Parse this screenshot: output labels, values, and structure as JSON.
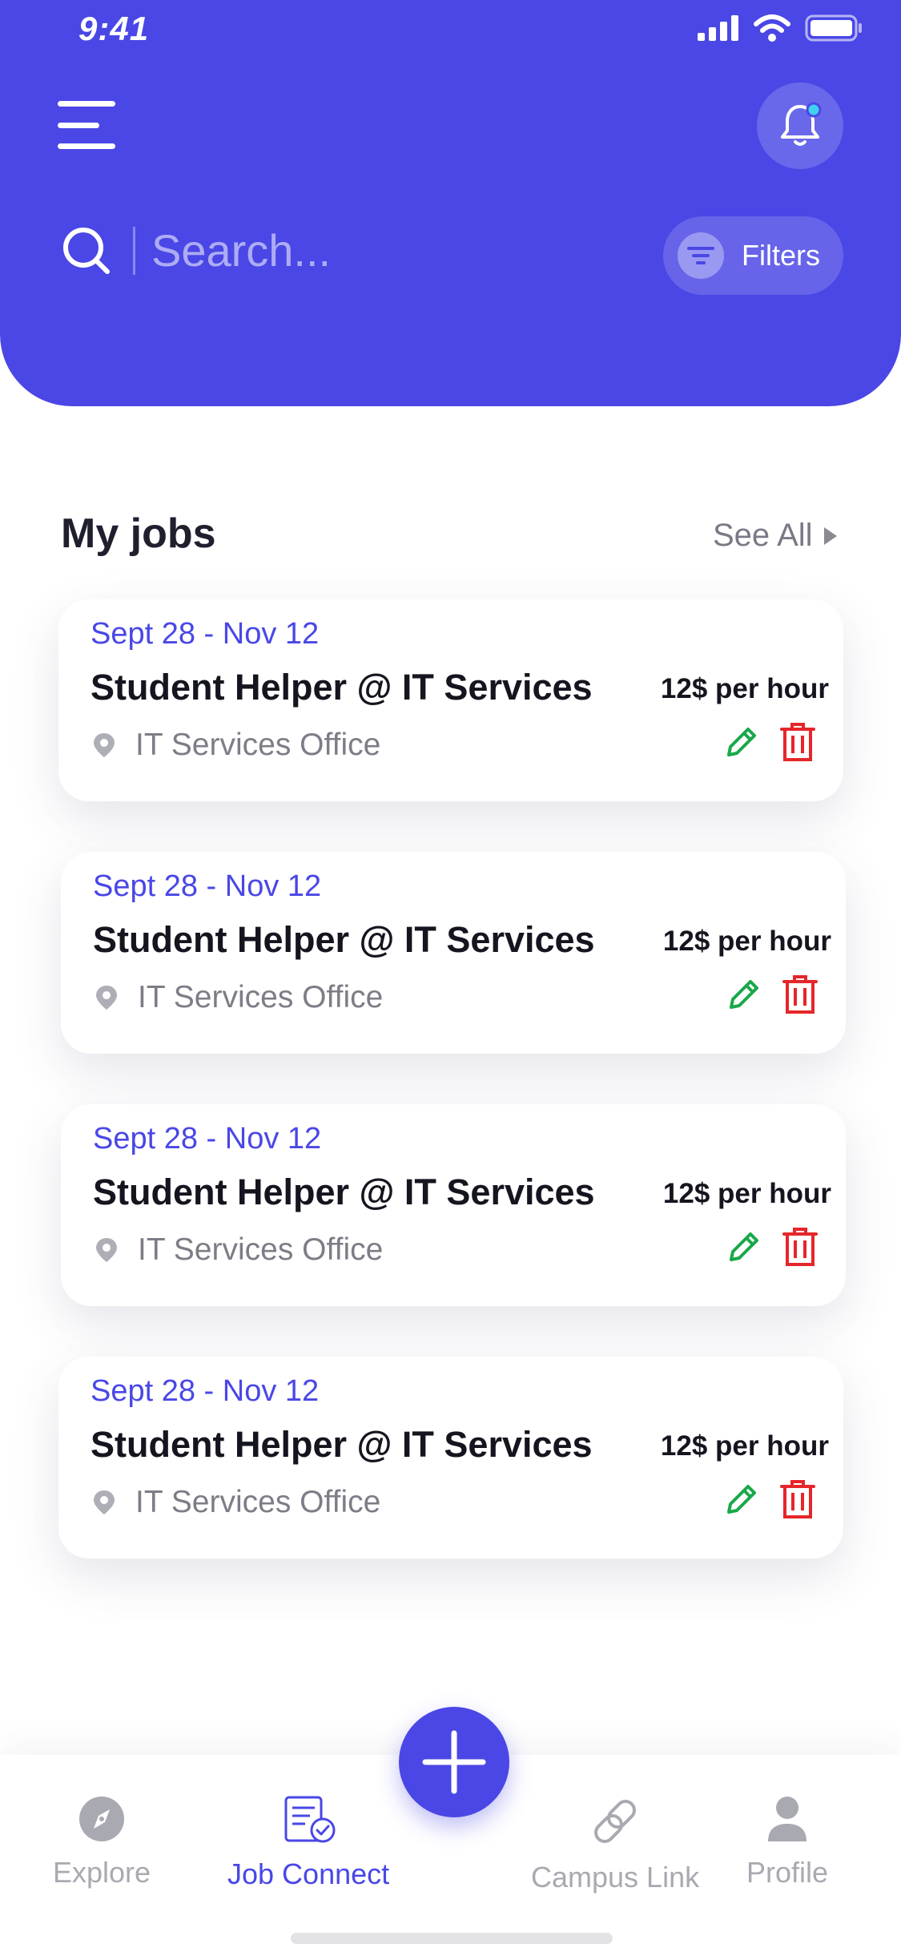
{
  "status_bar": {
    "time": "9:41"
  },
  "header": {
    "search": {
      "placeholder": "Search..."
    },
    "filters_label": "Filters"
  },
  "section": {
    "title": "My jobs",
    "see_all_label": "See All"
  },
  "jobs": [
    {
      "date_range": "Sept 28 - Nov 12",
      "title": "Student Helper @ IT Services",
      "rate": "12$ per hour",
      "location": "IT Services Office"
    },
    {
      "date_range": "Sept 28 - Nov 12",
      "title": "Student Helper @ IT Services",
      "rate": "12$ per hour",
      "location": "IT Services Office"
    },
    {
      "date_range": "Sept 28 - Nov 12",
      "title": "Student Helper @ IT Services",
      "rate": "12$ per hour",
      "location": "IT Services Office"
    },
    {
      "date_range": "Sept 28 - Nov 12",
      "title": "Student Helper @ IT Services",
      "rate": "12$ per hour",
      "location": "IT Services Office"
    }
  ],
  "bottom_nav": {
    "items": [
      {
        "label": "Explore",
        "icon": "compass-icon",
        "active": false
      },
      {
        "label": "Job Connect",
        "icon": "job-document-icon",
        "active": true
      },
      {
        "label": "Campus Link",
        "icon": "link-icon",
        "active": false
      },
      {
        "label": "Profile",
        "icon": "user-icon",
        "active": false
      }
    ]
  },
  "colors": {
    "primary": "#4a47e6",
    "edit": "#19a84a",
    "delete": "#e5262a",
    "notification_dot": "#3fd0f0"
  }
}
